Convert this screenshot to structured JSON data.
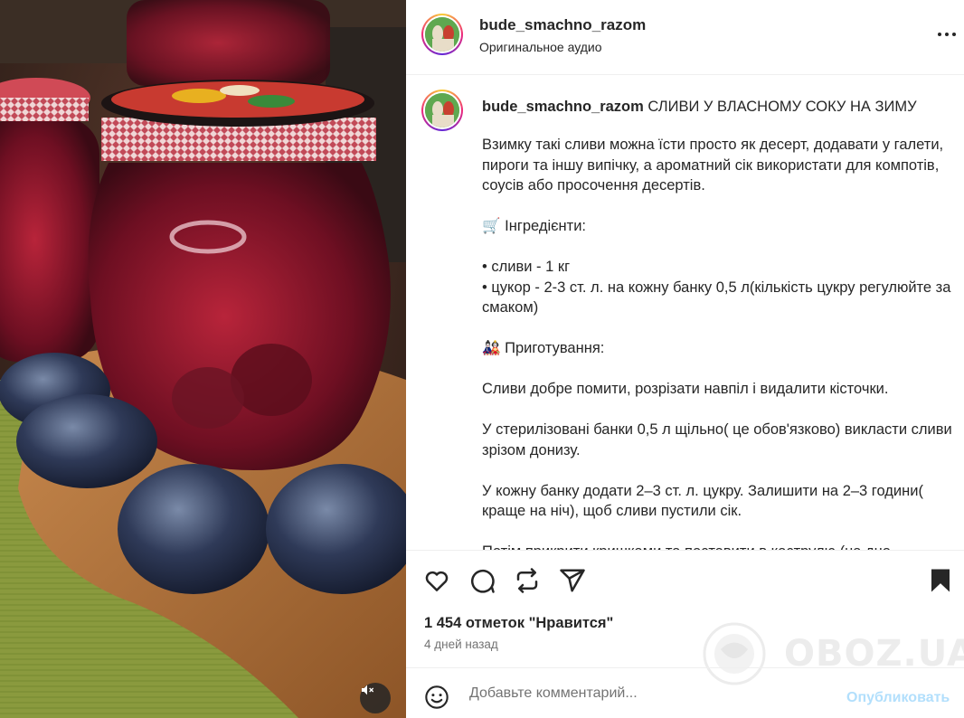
{
  "post": {
    "username": "bude_smachno_razom",
    "audio": "Оригинальное аудио",
    "caption_title": "СЛИВИ У ВЛАСНОМУ СОКУ НА ЗИМУ",
    "caption": {
      "intro": "Взимку такі сливи можна їсти просто як десерт, додавати у галети, пироги та іншу випічку, а ароматний сік використати для компотів, соусів або просочення десертів.",
      "ingredients_heading": "🛒 Інгредієнти:",
      "ingredient_1": "• сливи - 1 кг",
      "ingredient_2": "• цукор - 2-3 ст. л. на кожну банку 0,5 л(кількість цукру регулюйте за смаком)",
      "prep_heading": "🎎 Приготування:",
      "step_1": "Сливи добре помити, розрізати навпіл і видалити кісточки.",
      "step_2": "У стерилізовані банки 0,5 л щільно( це обов'язково) викласти сливи зрізом донизу.",
      "step_3": "У кожну банку додати 2–3 ст. л. цукру. Залишити на 2–3 години( краще на ніч), щоб сливи пустили сік.",
      "step_4": "Потім прикрити кришками та поставити в каструлю (на дно - ганчірку)"
    },
    "likes": "1 454 отметок \"Нравится\"",
    "time_ago": "4 дней назад"
  },
  "comment": {
    "placeholder": "Добавьте комментарий...",
    "post_label": "Опубликовать"
  },
  "watermark": "OBOZ.UA",
  "icons": {
    "like": "heart-icon",
    "comment": "comment-icon",
    "repost": "repost-icon",
    "share": "share-icon",
    "save": "bookmark-icon",
    "more": "more-icon",
    "emoji": "emoji-icon",
    "mute": "muted-speaker-icon"
  }
}
